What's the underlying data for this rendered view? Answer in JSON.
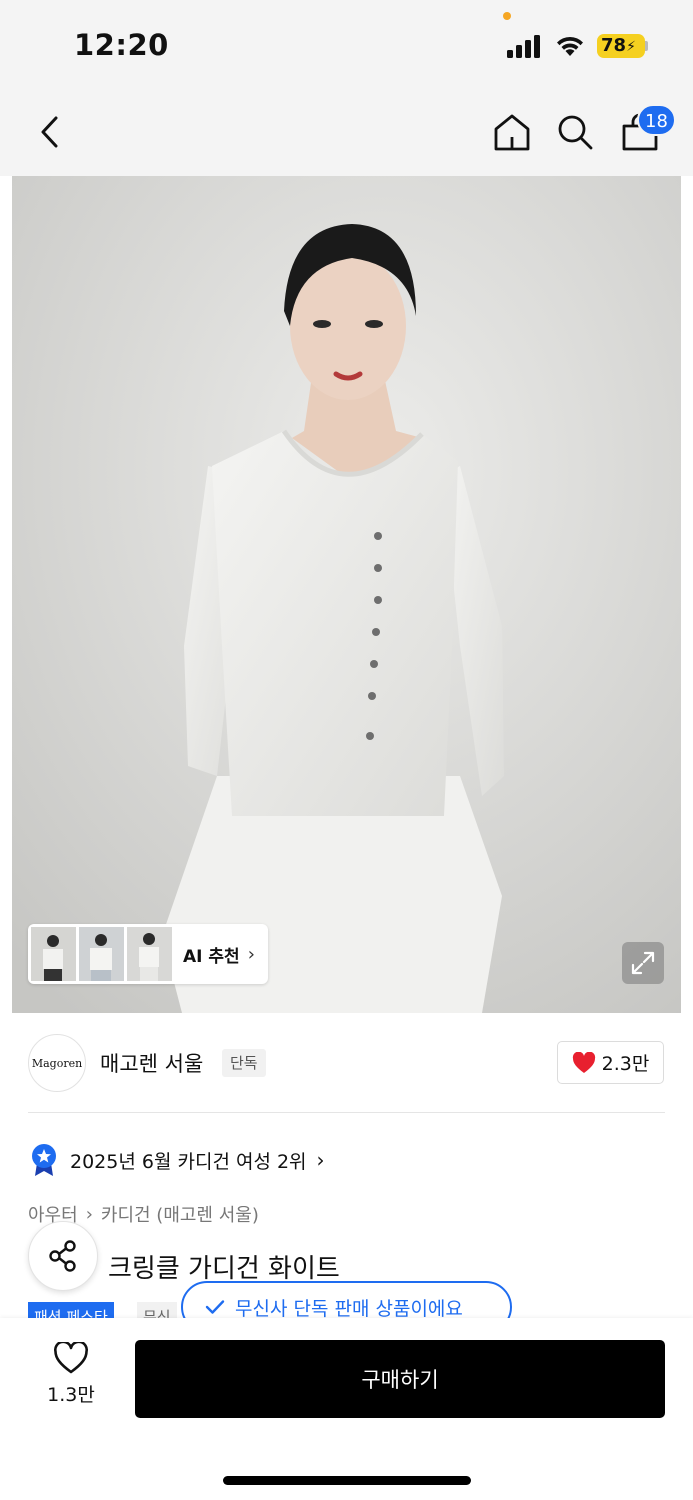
{
  "status": {
    "time": "12:20",
    "battery": "78"
  },
  "nav": {
    "cart_count": "18",
    "icons": [
      "chevron-left-icon",
      "home-icon",
      "search-icon",
      "bag-icon"
    ]
  },
  "gallery": {
    "ai_label": "AI 추천"
  },
  "brand": {
    "logo_text": "Magoren",
    "name": "매고렌 서울",
    "exclusive": "단독",
    "likes": "2.3만",
    "accent": "#1e6cf0",
    "heart_color": "#e8202f"
  },
  "ranking": {
    "text": "2025년 6월 카디건 여성 2위"
  },
  "breadcrumb": {
    "items": [
      "아우터",
      "카디건 (매고렌 서울)"
    ]
  },
  "product": {
    "title": "크링클 가디건 화이트"
  },
  "tags": {
    "fest": "패션 페스타",
    "grey": "무신"
  },
  "tooltip": {
    "text": "무신사 단독 판매 상품이에요"
  },
  "bottom": {
    "wish_count": "1.3만",
    "buy_label": "구매하기"
  }
}
